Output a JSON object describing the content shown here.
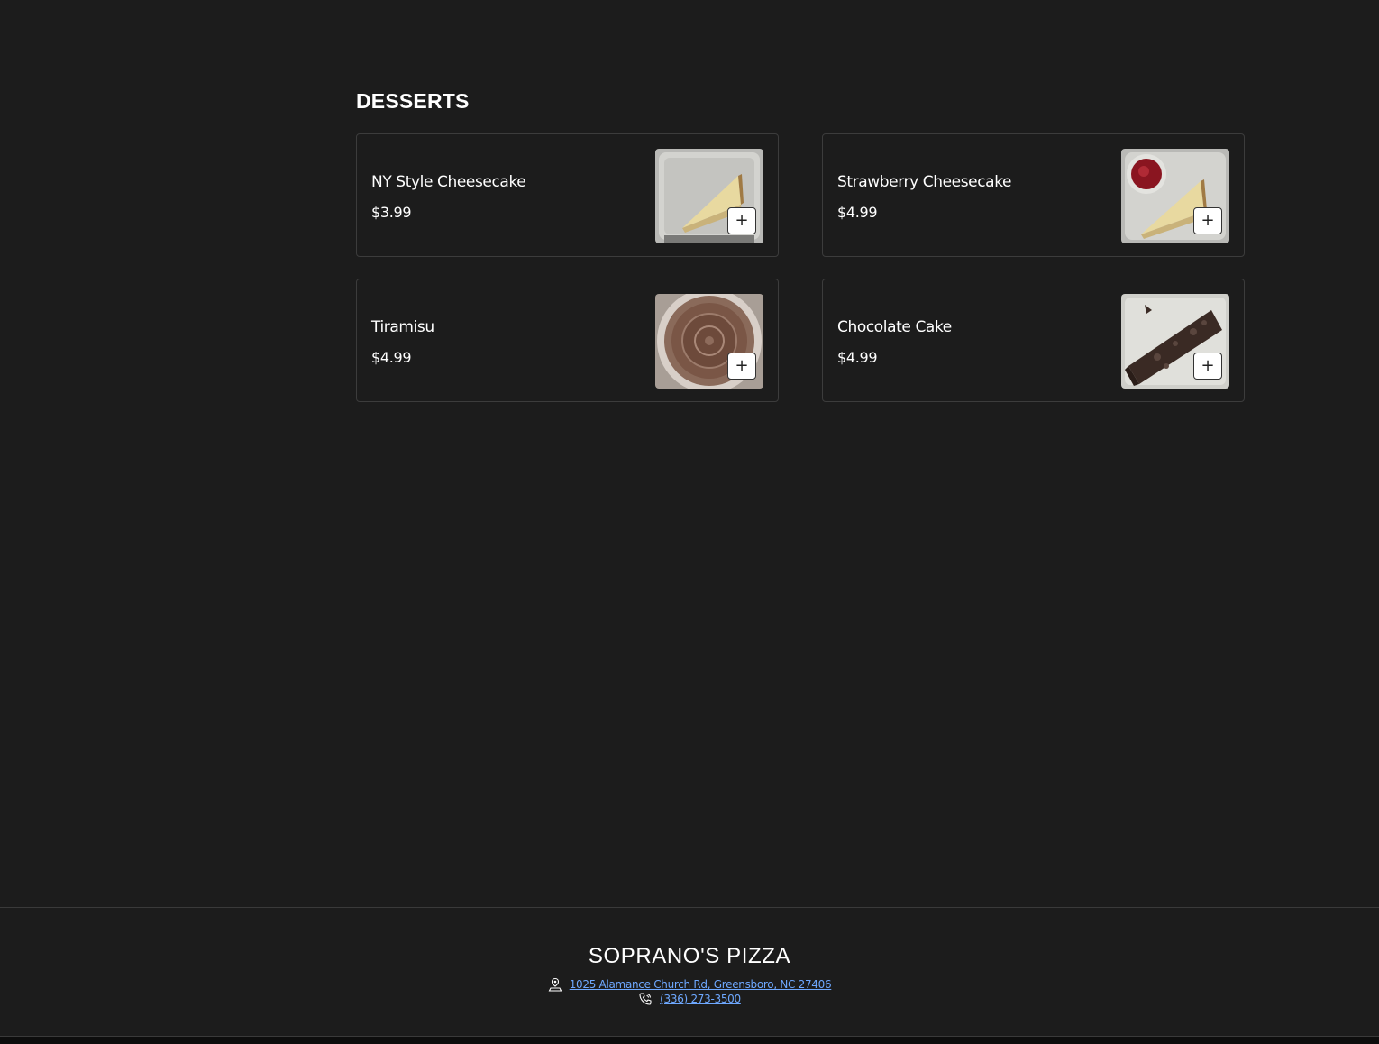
{
  "menu": {
    "section_title": "DESSERTS",
    "items": [
      {
        "name": "NY Style Cheesecake",
        "price": "$3.99",
        "image": "cheesecake-photo",
        "add_label": "+"
      },
      {
        "name": "Strawberry Cheesecake",
        "price": "$4.99",
        "image": "strawberry-cheesecake-photo",
        "add_label": "+"
      },
      {
        "name": "Tiramisu",
        "price": "$4.99",
        "image": "tiramisu-photo",
        "add_label": "+"
      },
      {
        "name": "Chocolate Cake",
        "price": "$4.99",
        "image": "chocolate-cake-photo",
        "add_label": "+"
      }
    ]
  },
  "footer": {
    "restaurant_name": "SOPRANO'S PIZZA",
    "address": "1025 Alamance Church Rd, Greensboro, NC 27406",
    "phone": "(336) 273-3500",
    "address_icon": "location-pin-icon",
    "phone_icon": "phone-icon"
  },
  "colors": {
    "background": "#1c1c1c",
    "card_border": "#3c3c3c",
    "link": "#6ea8ff",
    "text": "#ffffff"
  }
}
